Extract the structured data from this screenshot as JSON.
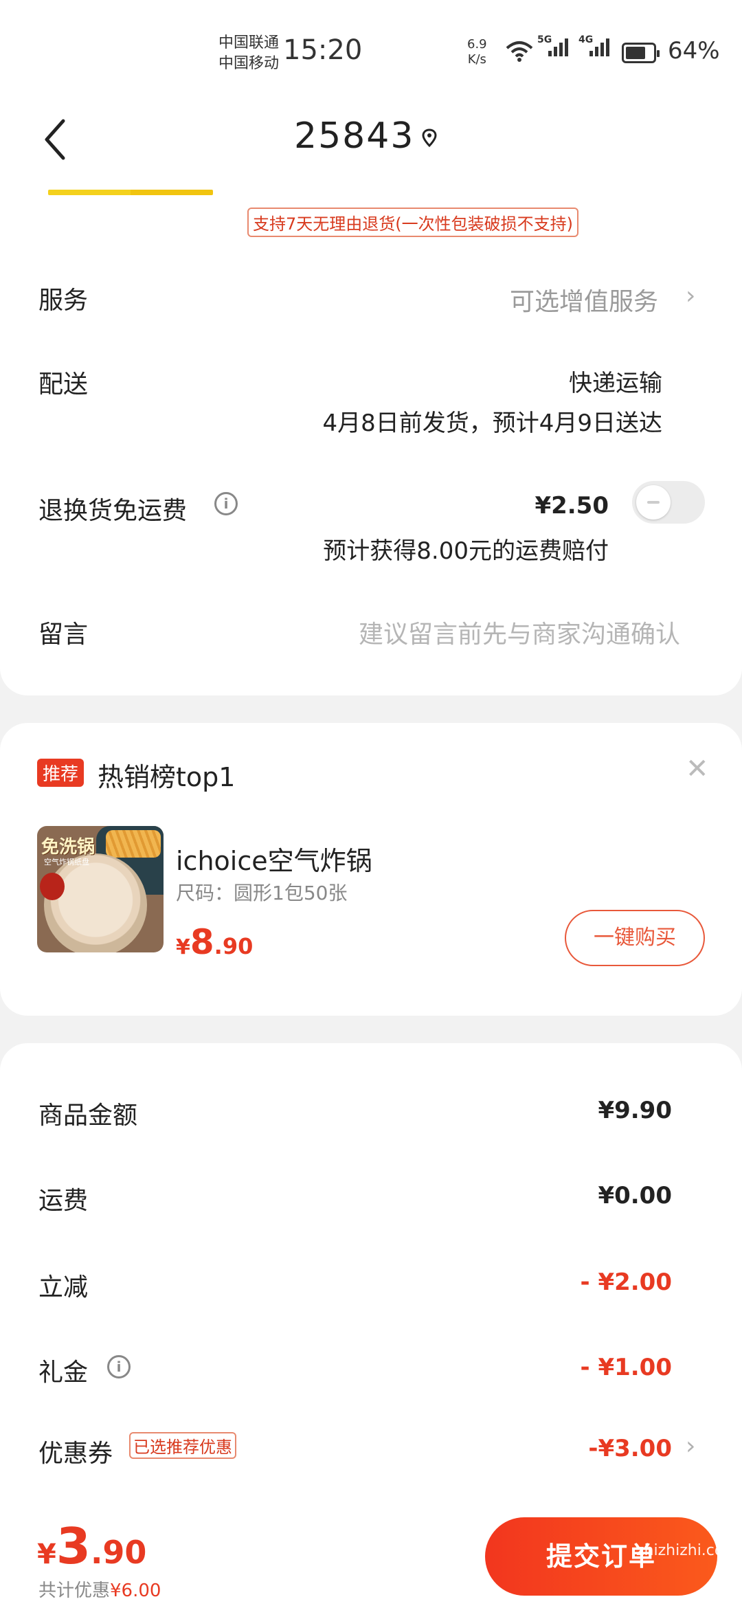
{
  "status": {
    "carrier1": "中国联通",
    "carrier2": "中国移动",
    "time": "15:20",
    "speed1": "6.9",
    "speed2": "K/s",
    "net1": "5G",
    "net2": "4G",
    "battery": "64%"
  },
  "header": {
    "title": "25843"
  },
  "policy": "支持7天无理由退货(一次性包装破损不支持)",
  "rows": {
    "service_label": "服务",
    "service_value": "可选增值服务",
    "delivery_label": "配送",
    "delivery_method": "快递运输",
    "delivery_eta": "4月8日前发货，预计4月9日送达",
    "return_label": "退换货免运费",
    "return_price": "¥2.50",
    "return_note": "预计获得8.00元的运费赔付",
    "message_label": "留言",
    "message_placeholder": "建议留言前先与商家沟通确认"
  },
  "recommend": {
    "tag": "推荐",
    "title": "热销榜top1",
    "thumb_brand": "免洗锅",
    "thumb_sub": "空气炸锅纸盘",
    "product_name": "ichoice空气炸锅",
    "spec": "尺码：圆形1包50张",
    "price_symbol": "¥",
    "price_int": "8",
    "price_dec": ".90",
    "buy_label": "一键购买"
  },
  "summary": {
    "goods_label": "商品金额",
    "goods_value": "¥9.90",
    "shipping_label": "运费",
    "shipping_value": "¥0.00",
    "discount_label": "立减",
    "discount_value": "- ¥2.00",
    "gift_label": "礼金",
    "gift_value": "- ¥1.00",
    "coupon_label": "优惠券",
    "coupon_tag": "已选推荐优惠",
    "coupon_value": "-¥3.00"
  },
  "bottom": {
    "symbol": "¥",
    "total_int": "3",
    "total_dec": ".90",
    "saved_label": "共计优惠",
    "saved_value": "¥6.00",
    "submit_label": "提交订单"
  },
  "watermark": "zhizhizhi.com",
  "colors": {
    "accent": "#e83a22",
    "progress": "#f4d11d"
  }
}
